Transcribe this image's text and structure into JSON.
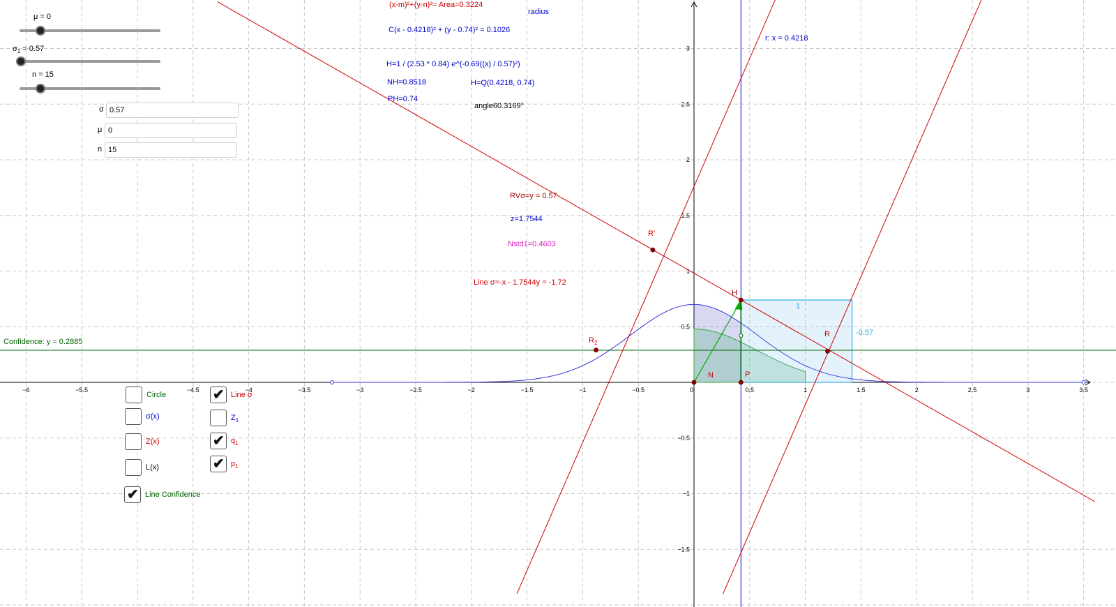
{
  "colors": {
    "red": "#cc0000",
    "dark_red": "#a00000",
    "blue": "#0000cc",
    "magenta": "#e020c0",
    "green": "#006600",
    "bright_green": "#00aa00",
    "light_blue": "#33aadd",
    "grid": "#c8c8c8"
  },
  "sliders": [
    {
      "label": "μ = 0",
      "value": 0,
      "min": -5,
      "max": 5
    },
    {
      "label_main": "σ",
      "label_sub": "1",
      "label_rest": " = 0.57",
      "value": 0.57,
      "min": 0.5,
      "max": 10
    },
    {
      "label": "n = 15",
      "value": 15,
      "min": 10,
      "max": 200
    }
  ],
  "inputs": [
    {
      "label": "σ",
      "value": "0.57"
    },
    {
      "label": "μ",
      "value": "0"
    },
    {
      "label": "n",
      "value": "15"
    }
  ],
  "checkboxes_left": [
    {
      "label": "Circle",
      "checked": false,
      "color": "#006600"
    },
    {
      "label": "σ(x)",
      "checked": false,
      "color": "#0000cc"
    },
    {
      "label": "Z(x)",
      "checked": false,
      "color": "#cc0000"
    },
    {
      "label": "L(x)",
      "checked": false,
      "color": "#000000"
    },
    {
      "label": "Line Confidence",
      "checked": true,
      "color": "#006600"
    }
  ],
  "checkboxes_right": [
    {
      "label": "Line σ",
      "checked": true,
      "color": "#cc0000"
    },
    {
      "label_main": "Z",
      "label_sub": "1",
      "checked": false,
      "color": "#0000cc"
    },
    {
      "label_main": "q",
      "label_sub": "1",
      "checked": true,
      "color": "#cc0000"
    },
    {
      "label_main": "p",
      "label_sub": "1",
      "checked": true,
      "color": "#cc0000"
    }
  ],
  "texts": {
    "area": "(x-m)²+(y-n)²= Area=0.3224",
    "radius": "radius",
    "circle_eq": "C(x - 0.4218)² + (y - 0.74)² = 0.1026",
    "r_line": "r: x = 0.4218",
    "h_func": "H=1 / (2.53 * 0.84) ℯ^(-0.69((x) / 0.57)²)",
    "nh": "NH=0.8518",
    "hq": "H=Q(0.4218, 0.74)",
    "ph": "PH=0.74",
    "angle": "angle60.3169°",
    "rv": "RVσ=y = 0.57",
    "z": "z=1.7544",
    "nstd": "Nstd1=0.4603",
    "line_sigma": "Line σ=-x - 1.7544y = -1.72",
    "confidence": "Confidence: y = 0.2885",
    "rect_top": "1",
    "rect_side": "-0.57"
  },
  "points": {
    "H": "H",
    "R": "R",
    "R_prime": "R'",
    "R2_main": "R",
    "R2_sub": "2",
    "N": "N",
    "P": "P"
  },
  "axes": {
    "x_ticks": [
      "-6",
      "-5.5",
      "-5",
      "-4.5",
      "-4",
      "-3.5",
      "-3",
      "-2.5",
      "-2",
      "-1.5",
      "-1",
      "-0.5",
      "0",
      "0.5",
      "1",
      "1.5",
      "2",
      "2.5",
      "3",
      "3.5"
    ],
    "y_ticks": [
      "3",
      "2.5",
      "2",
      "1.5",
      "1",
      "0.5",
      "-0.5",
      "-1",
      "-1.5"
    ]
  },
  "graph": {
    "mu": 0,
    "sigma": 0.57,
    "confidence_y": 0.2885,
    "r_x": 0.4218,
    "H": [
      0.4218,
      0.74
    ],
    "R": [
      1.2,
      0.28
    ],
    "R_prime": [
      -0.37,
      1.19
    ],
    "R2": [
      -0.88,
      0.29
    ],
    "rect": [
      0.4218,
      0,
      1.42,
      0.74
    ],
    "line_sigma": {
      "a": -1,
      "b": -1.7544,
      "c": -1.72
    },
    "line_q1": {
      "slope": 2.3,
      "intercept": 1.76
    },
    "line_p1": {
      "slope": 2.3,
      "intercept": -2.5
    }
  }
}
